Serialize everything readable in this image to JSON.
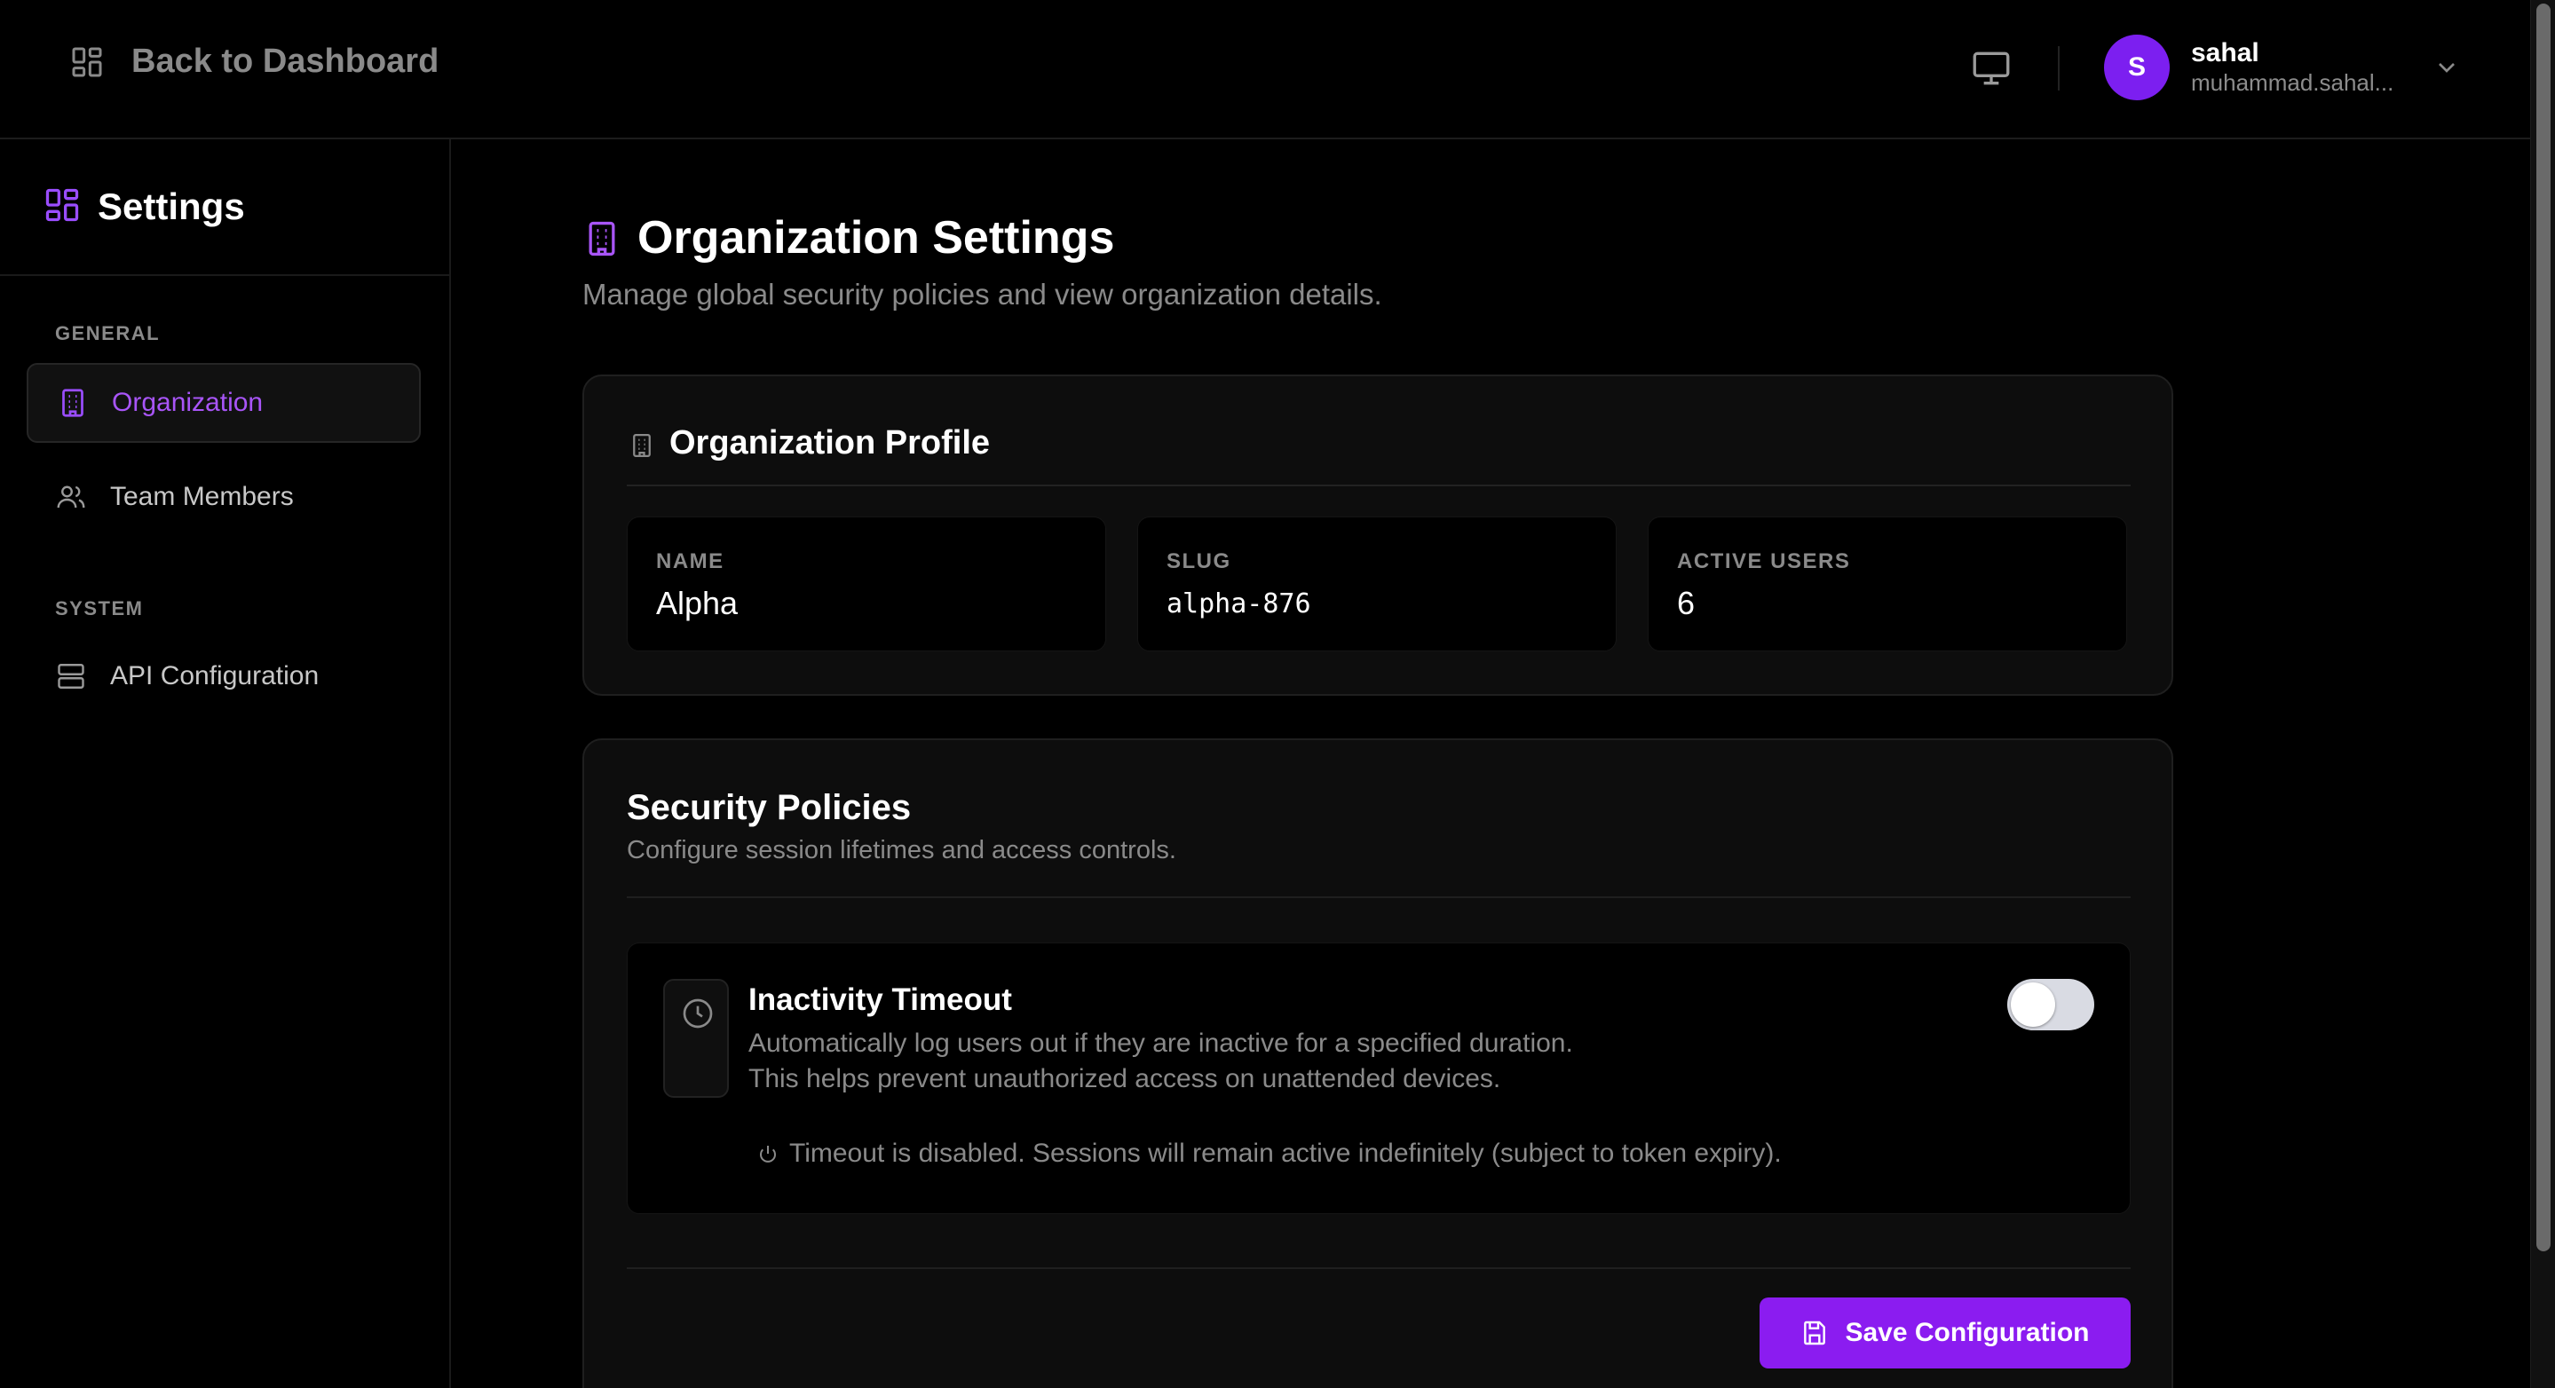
{
  "header": {
    "back_label": "Back to Dashboard",
    "user": {
      "initial": "S",
      "name": "sahal",
      "email": "muhammad.sahal..."
    }
  },
  "sidebar": {
    "title": "Settings",
    "sections": [
      {
        "label": "GENERAL"
      },
      {
        "label": "SYSTEM"
      }
    ],
    "items": [
      {
        "label": "Organization",
        "icon": "building-icon",
        "active": true
      },
      {
        "label": "Team Members",
        "icon": "users-icon",
        "active": false
      },
      {
        "label": "API Configuration",
        "icon": "server-icon",
        "active": false
      }
    ]
  },
  "main": {
    "title": "Organization Settings",
    "subtitle": "Manage global security policies and view organization details.",
    "profile": {
      "title": "Organization Profile",
      "stats": [
        {
          "label": "NAME",
          "value": "Alpha"
        },
        {
          "label": "SLUG",
          "value": "alpha-876"
        },
        {
          "label": "ACTIVE USERS",
          "value": "6"
        }
      ]
    },
    "security": {
      "title": "Security Policies",
      "subtitle": "Configure session lifetimes and access controls.",
      "inactivity": {
        "title": "Inactivity Timeout",
        "description_line1": "Automatically log users out if they are inactive for a specified duration.",
        "description_line2": "This helps prevent unauthorized access on unattended devices.",
        "enabled": false,
        "status": "Timeout is disabled. Sessions will remain active indefinitely (subject to token expiry)."
      },
      "save_label": "Save Configuration"
    }
  },
  "colors": {
    "accent": "#8b1cf0",
    "accent_text": "#a855f7",
    "background": "#000000",
    "card": "#0d0d0d",
    "muted_text": "#8a8a8a"
  }
}
